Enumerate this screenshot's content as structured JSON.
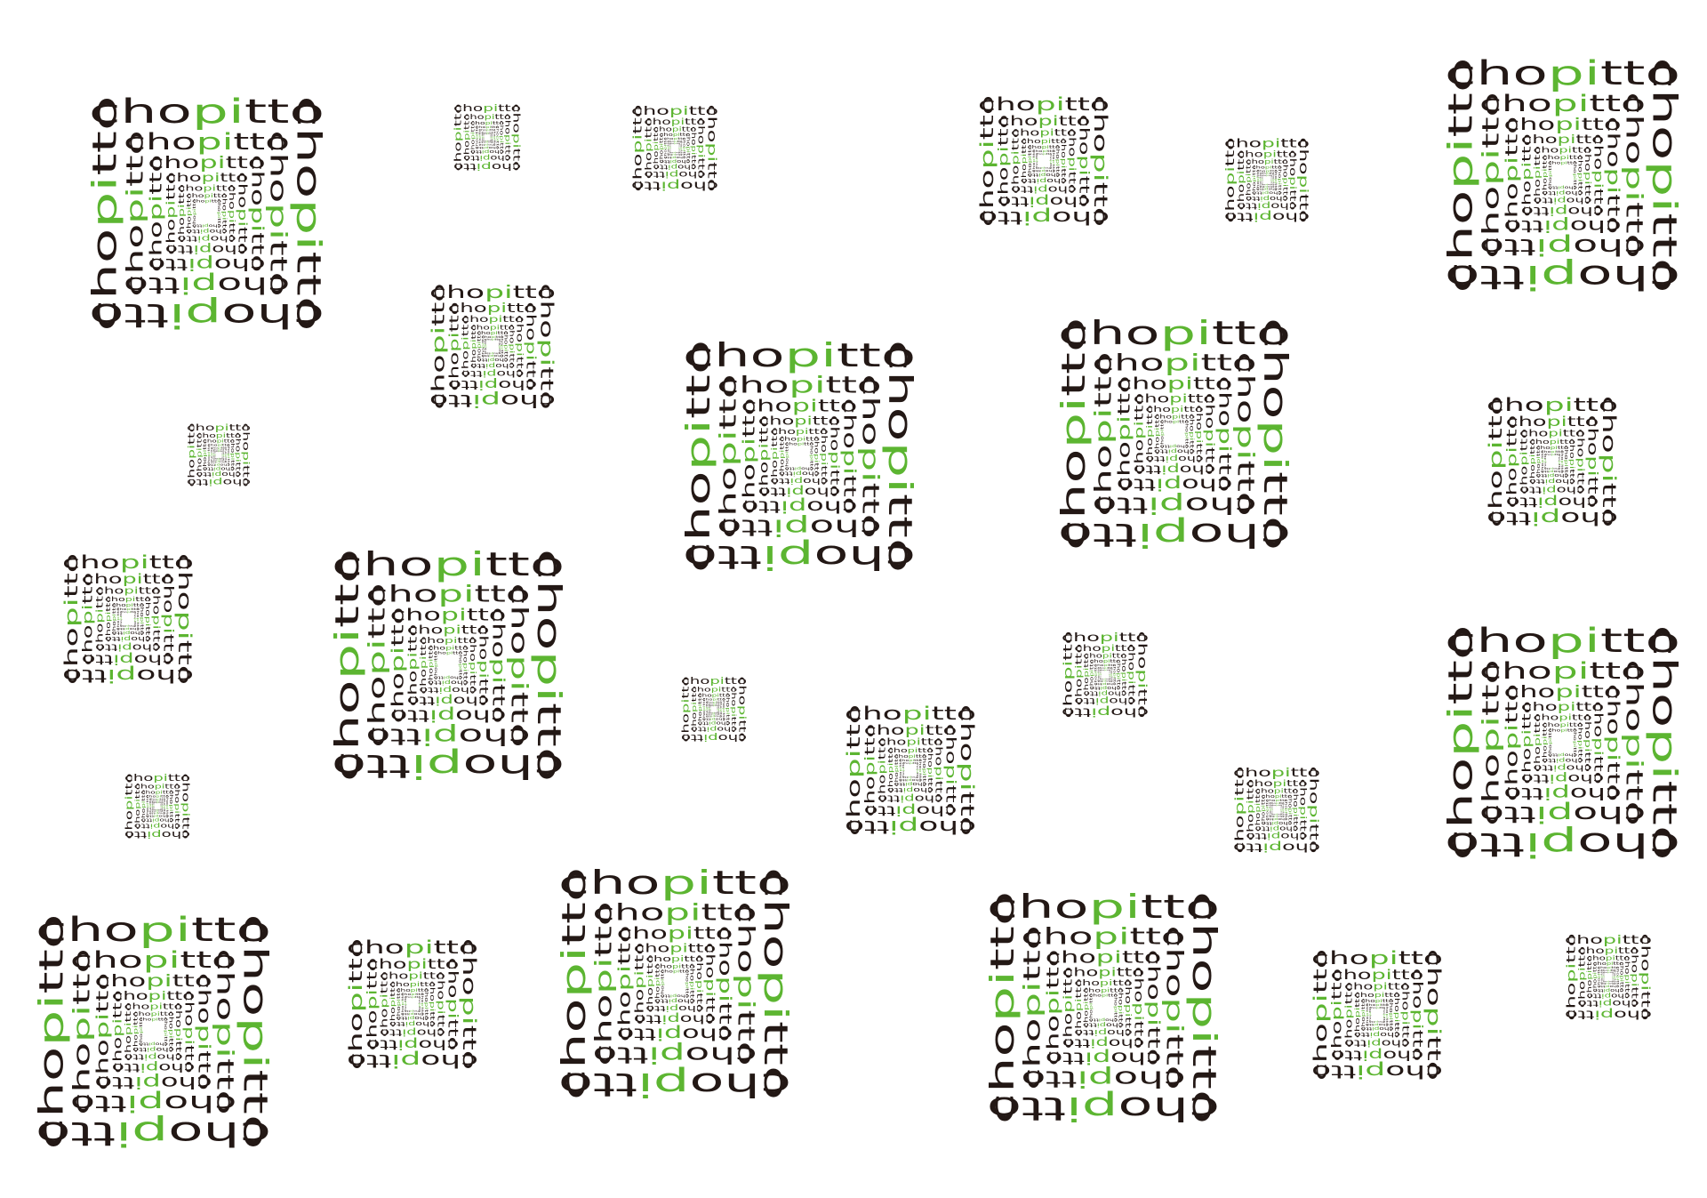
{
  "pattern": {
    "word": "chopitto",
    "colors": {
      "ink": "#231815",
      "accent": "#5cb531",
      "background": "#ffffff"
    }
  }
}
